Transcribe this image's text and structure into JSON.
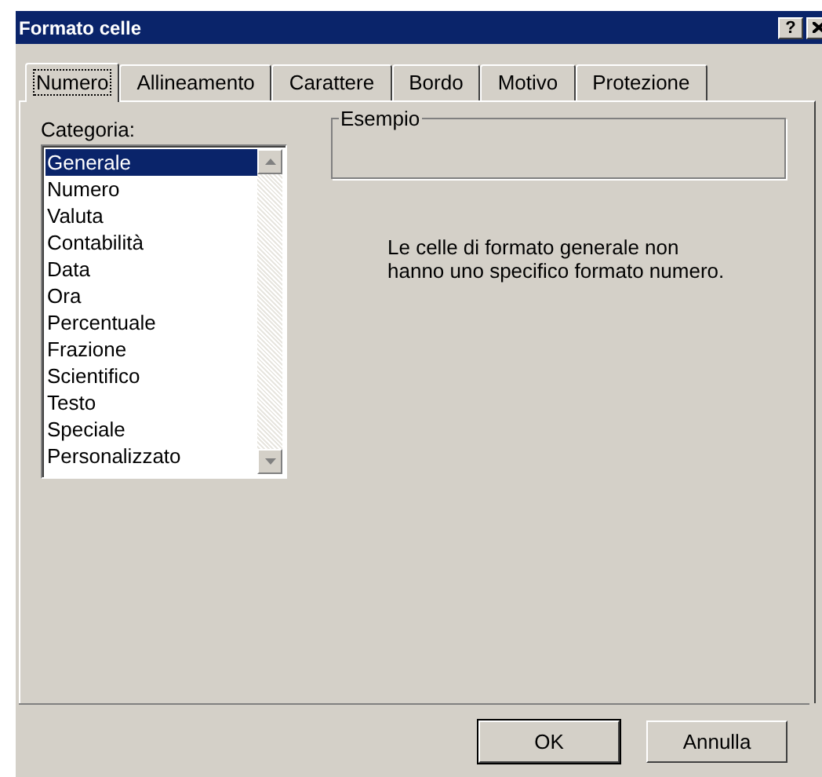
{
  "window": {
    "title": "Formato celle",
    "help_button": "?"
  },
  "tabs": [
    {
      "label": "Numero",
      "selected": true
    },
    {
      "label": "Allineamento",
      "selected": false
    },
    {
      "label": "Carattere",
      "selected": false
    },
    {
      "label": "Bordo",
      "selected": false
    },
    {
      "label": "Motivo",
      "selected": false
    },
    {
      "label": "Protezione",
      "selected": false
    }
  ],
  "category": {
    "label": "Categoria:",
    "items": [
      {
        "label": "Generale",
        "selected": true
      },
      {
        "label": "Numero",
        "selected": false
      },
      {
        "label": "Valuta",
        "selected": false
      },
      {
        "label": "Contabilità",
        "selected": false
      },
      {
        "label": "Data",
        "selected": false
      },
      {
        "label": "Ora",
        "selected": false
      },
      {
        "label": "Percentuale",
        "selected": false
      },
      {
        "label": "Frazione",
        "selected": false
      },
      {
        "label": "Scientifico",
        "selected": false
      },
      {
        "label": "Testo",
        "selected": false
      },
      {
        "label": "Speciale",
        "selected": false
      },
      {
        "label": "Personalizzato",
        "selected": false
      }
    ]
  },
  "sample": {
    "label": "Esempio"
  },
  "description": "Le celle di formato generale non hanno uno specifico formato numero.",
  "buttons": [
    "OK",
    "Annulla"
  ]
}
